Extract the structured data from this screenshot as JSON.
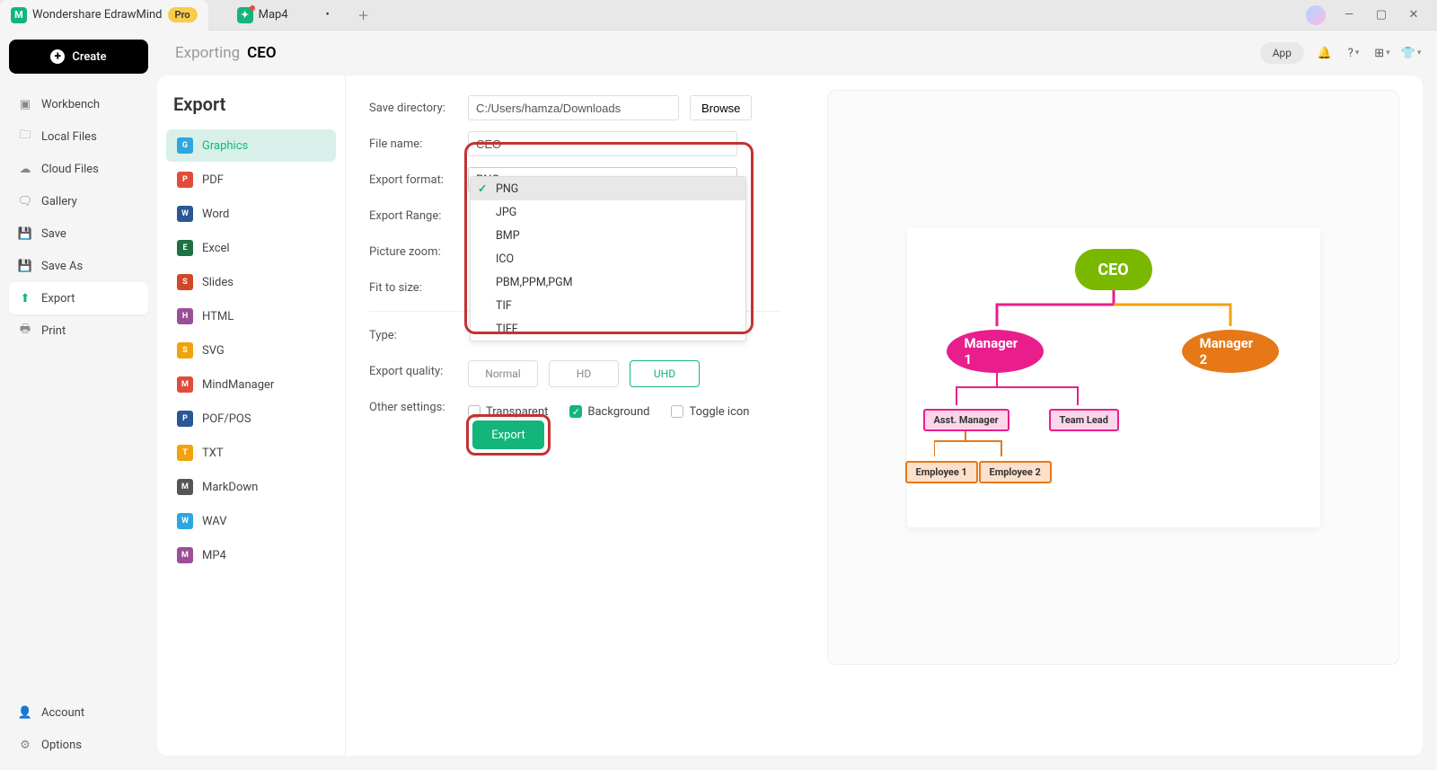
{
  "titlebar": {
    "app_name": "Wondershare EdrawMind",
    "pro_badge": "Pro",
    "tab2": "Map4"
  },
  "sidebar": {
    "create": "Create",
    "items": [
      {
        "label": "Workbench"
      },
      {
        "label": "Local Files"
      },
      {
        "label": "Cloud Files"
      },
      {
        "label": "Gallery"
      },
      {
        "label": "Save"
      },
      {
        "label": "Save As"
      },
      {
        "label": "Export"
      },
      {
        "label": "Print"
      }
    ],
    "account": "Account",
    "options": "Options"
  },
  "breadcrumb": {
    "a": "Exporting",
    "b": "CEO"
  },
  "topbar": {
    "app_pill": "App"
  },
  "export_panel": {
    "title": "Export",
    "types": [
      {
        "label": "Graphics",
        "color": "#2ea6e0"
      },
      {
        "label": "PDF",
        "color": "#e24b3b"
      },
      {
        "label": "Word",
        "color": "#2b5797"
      },
      {
        "label": "Excel",
        "color": "#1e7145"
      },
      {
        "label": "Slides",
        "color": "#d24726"
      },
      {
        "label": "HTML",
        "color": "#9b4f96"
      },
      {
        "label": "SVG",
        "color": "#f0a30a"
      },
      {
        "label": "MindManager",
        "color": "#e24b3b"
      },
      {
        "label": "POF/POS",
        "color": "#2b5797"
      },
      {
        "label": "TXT",
        "color": "#f0a30a"
      },
      {
        "label": "MarkDown",
        "color": "#555"
      },
      {
        "label": "WAV",
        "color": "#2ea6e0"
      },
      {
        "label": "MP4",
        "color": "#9b4f96"
      }
    ]
  },
  "form": {
    "save_dir_label": "Save directory:",
    "save_dir_value": "C:/Users/hamza/Downloads",
    "browse": "Browse",
    "file_name_label": "File name:",
    "file_name_value": "CEO",
    "export_format_label": "Export format:",
    "export_format_value": "PNG",
    "format_options": [
      "PNG",
      "JPG",
      "BMP",
      "ICO",
      "PBM,PPM,PGM",
      "TIF",
      "TIFF"
    ],
    "export_range_label": "Export Range:",
    "picture_zoom_label": "Picture zoom:",
    "fit_to_size_label": "Fit to size:",
    "type_label": "Type:",
    "quality_label": "Export quality:",
    "quality_opts": [
      "Normal",
      "HD",
      "UHD"
    ],
    "other_settings_label": "Other settings:",
    "cb_transparent": "Transparent",
    "cb_background": "Background",
    "cb_toggle": "Toggle icon",
    "export_btn": "Export"
  },
  "preview": {
    "ceo": "CEO",
    "mgr1": "Manager 1",
    "mgr2": "Manager 2",
    "asst": "Asst. Manager",
    "lead": "Team Lead",
    "emp1": "Employee 1",
    "emp2": "Employee 2"
  }
}
